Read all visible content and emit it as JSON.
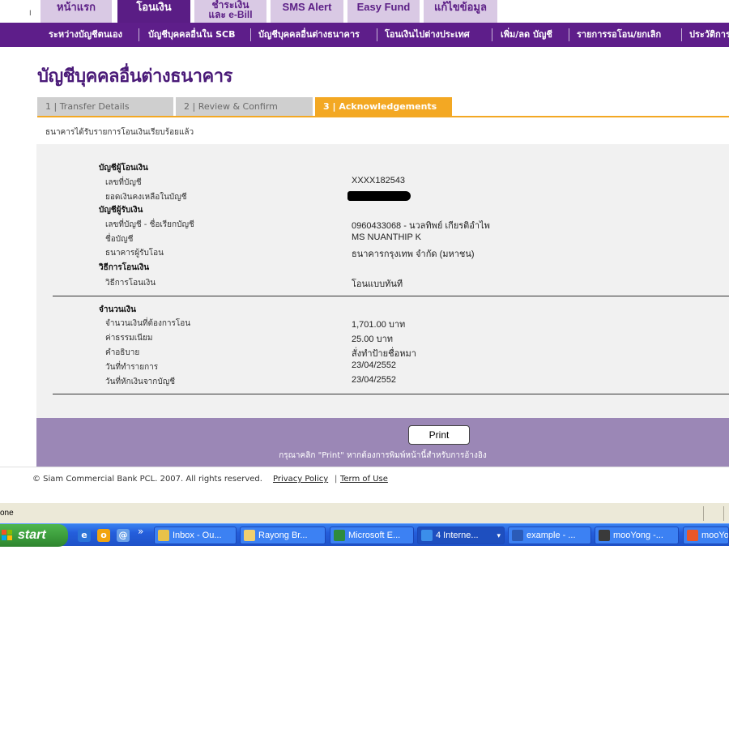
{
  "top_tabs": [
    {
      "label": "หน้าแรก"
    },
    {
      "label": "โอนเงิน"
    },
    {
      "label_line1": "ชำระเงิน",
      "label_line2": "และ e-Bill"
    },
    {
      "label": "SMS Alert"
    },
    {
      "label": "Easy Fund"
    },
    {
      "label": "แก้ไขข้อมูล"
    }
  ],
  "top_edge_mark": "I",
  "sub_nav": [
    "ระหว่างบัญชีตนเอง",
    "บัญชีบุคคลอื่นใน SCB",
    "บัญชีบุคคลอื่นต่างธนาคาร",
    "โอนเงินไปต่างประเทศ",
    "เพิ่ม/ลด บัญชี",
    "รายการรอโอน/ยกเลิก",
    "ประวัติการ"
  ],
  "page_title": "บัญชีบุคคลอื่นต่างธนาคาร",
  "steps": [
    "1 | Transfer Details",
    "2 | Review & Confirm",
    "3 | Acknowledgements"
  ],
  "confirmation_message": "ธนาคารได้รับรายการโอนเงินเรียบร้อยแล้ว",
  "details": {
    "from_heading": "บัญชีผู้โอนเงิน",
    "from_account_label": "เลขที่บัญชี",
    "from_account_value": "XXXX182543",
    "balance_label": "ยอดเงินคงเหลือในบัญชี",
    "to_heading": "บัญชีผู้รับเงิน",
    "to_account_label": "เลขที่บัญชี - ชื่อเรียกบัญชี",
    "to_account_value": "0960433068 - นวลทิพย์ เกียรติอำไพ",
    "account_name_label": "ชื่อบัญชี",
    "account_name_value": "MS NUANTHIP K",
    "bank_label": "ธนาคารผู้รับโอน",
    "bank_value": "ธนาคารกรุงเทพ จำกัด (มหาชน)",
    "method_heading": "วิธีการโอนเงิน",
    "method_label": "วิธีการโอนเงิน",
    "method_value": "โอนแบบทันที",
    "amount_heading": "จำนวนเงิน",
    "amount_label": "จำนวนเงินที่ต้องการโอน",
    "amount_value": "1,701.00 บาท",
    "fee_label": "ค่าธรรมเนียม",
    "fee_value": "25.00  บาท",
    "description_label": "คำอธิบาย",
    "description_value": "สั่งทำป้ายชื่อหมา",
    "transaction_date_label": "วันที่ทำรายการ",
    "transaction_date_value": "23/04/2552",
    "debit_date_label": "วันที่หักเงินจากบัญชี",
    "debit_date_value": "23/04/2552"
  },
  "print": {
    "button_label": "Print",
    "note": "กรุณาคลิก \"Print\" หากต้องการพิมพ์หน้านี้สำหรับการอ้างอิง"
  },
  "footer": {
    "copyright": "© Siam Commercial Bank PCL. 2007. All rights reserved.",
    "privacy": "Privacy Policy",
    "separator": "|",
    "terms": "Term of Use"
  },
  "status_bar": {
    "text": "one"
  },
  "taskbar": {
    "start_label": "start",
    "chevron": "»",
    "tasks": [
      "Inbox - Ou...",
      "Rayong Br...",
      "Microsoft E...",
      "4 Interne...",
      "example - ...",
      "mooYong -...",
      "mooYo"
    ]
  },
  "colors": {
    "brand_purple": "#5e1e8a",
    "active_step": "#f3a823",
    "print_band": "#9b87b6"
  }
}
